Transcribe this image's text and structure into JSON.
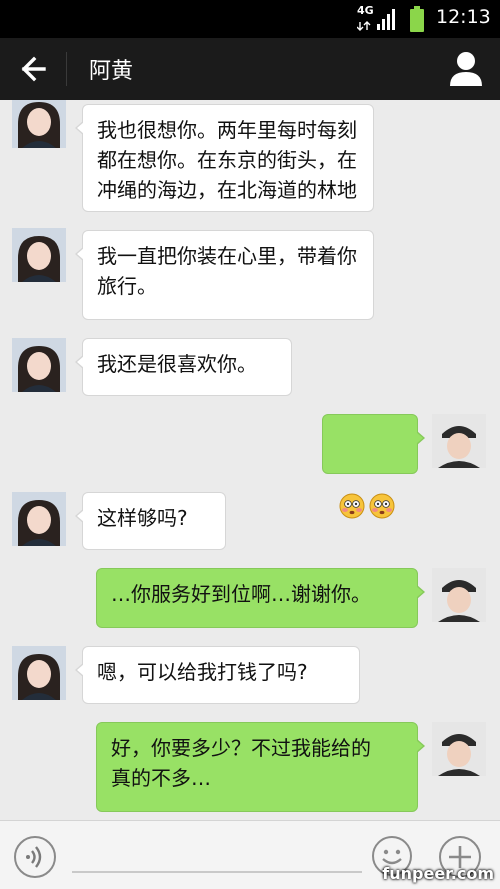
{
  "status_bar": {
    "network": "4G",
    "time": "12:13",
    "icons": [
      "signal-icon",
      "battery-icon"
    ]
  },
  "header": {
    "title": "阿黄",
    "icons": [
      "back-arrow-icon",
      "profile-icon"
    ]
  },
  "messages": [
    {
      "side": "in",
      "text": "我也很想你。两年里每时每刻\n都在想你。在东京的街头，在\n冲绳的海边，在北海道的林地"
    },
    {
      "side": "in",
      "text": "我一直把你装在心里，带着你\n旅行。"
    },
    {
      "side": "in",
      "text": "我还是很喜欢你。"
    },
    {
      "side": "out",
      "emoji": [
        "flushed-face-icon",
        "flushed-face-icon"
      ]
    },
    {
      "side": "in",
      "text": "这样够吗?"
    },
    {
      "side": "out",
      "text": "…你服务好到位啊…谢谢你。"
    },
    {
      "side": "in",
      "text": "嗯，可以给我打钱了吗?"
    },
    {
      "side": "out",
      "text": "好，你要多少？不过我能给的\n真的不多…"
    }
  ],
  "input_bar": {
    "icons": [
      "voice-icon",
      "emoji-icon",
      "plus-icon"
    ]
  },
  "watermark": "funpeer.com",
  "colors": {
    "outgoing_bubble": "#98e165",
    "incoming_bubble": "#ffffff",
    "chat_background": "#ebebeb",
    "title_bar": "#1b1b1b"
  }
}
